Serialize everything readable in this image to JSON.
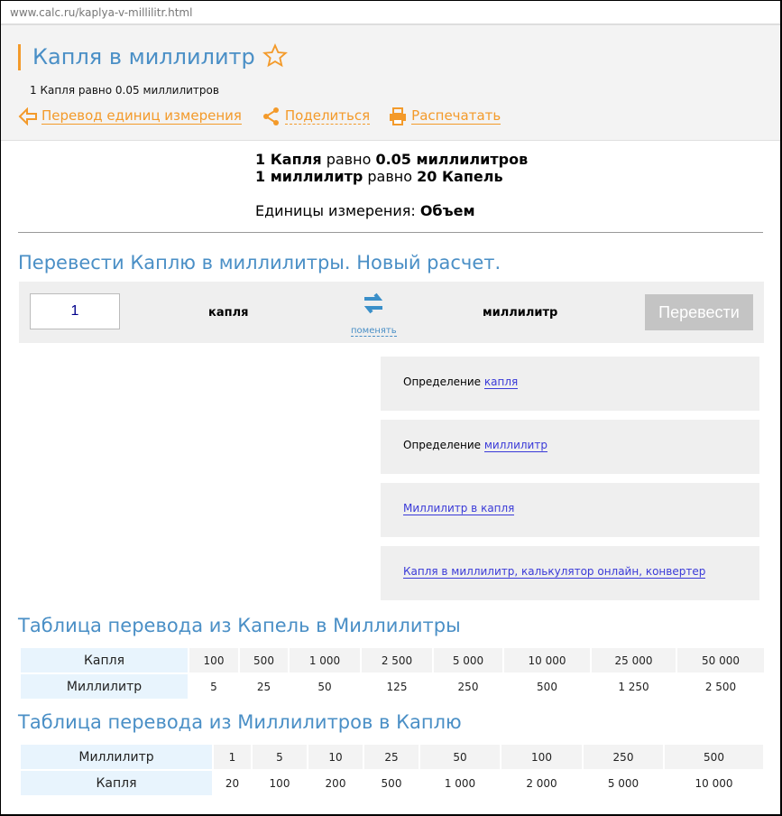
{
  "url": "www.calc.ru/kaplya-v-millilitr.html",
  "title": "Капля в миллилитр",
  "subtitle": "1 Капля равно 0.05 миллилитров",
  "links": {
    "back": "Перевод единиц измерения",
    "share": "Поделиться",
    "print": "Распечатать"
  },
  "result": {
    "l1a": "1 Капля",
    "l1b": " равно ",
    "l1c": "0.05 миллилитров",
    "l2a": "1 миллилитр",
    "l2b": " равно ",
    "l2c": "20 Капель",
    "unit_label": "Единицы измерения: ",
    "unit_value": "Объем"
  },
  "calc": {
    "heading": "Перевести Каплю в миллилитры. Новый расчет.",
    "value": "1",
    "from": "капля",
    "swap": "поменять",
    "to": "миллилитр",
    "button": "Перевести"
  },
  "boxes": [
    {
      "prefix": "Определение ",
      "link": "капля"
    },
    {
      "prefix": "Определение ",
      "link": "миллилитр"
    },
    {
      "prefix": "",
      "link": "Миллилитр в капля"
    },
    {
      "prefix": "",
      "link": "Капля в миллилитр, калькулятор онлайн, конвертер"
    }
  ],
  "table1": {
    "heading": "Таблица перевода из Капель в Миллилитры",
    "row1_label": "Капля",
    "row1": [
      "100",
      "500",
      "1 000",
      "2 500",
      "5 000",
      "10 000",
      "25 000",
      "50 000"
    ],
    "row2_label": "Миллилитр",
    "row2": [
      "5",
      "25",
      "50",
      "125",
      "250",
      "500",
      "1 250",
      "2 500"
    ]
  },
  "table2": {
    "heading": "Таблица перевода из Миллилитров в Каплю",
    "row1_label": "Миллилитр",
    "row1": [
      "1",
      "5",
      "10",
      "25",
      "50",
      "100",
      "250",
      "500"
    ],
    "row2_label": "Капля",
    "row2": [
      "20",
      "100",
      "200",
      "500",
      "1 000",
      "2 000",
      "5 000",
      "10 000"
    ]
  }
}
